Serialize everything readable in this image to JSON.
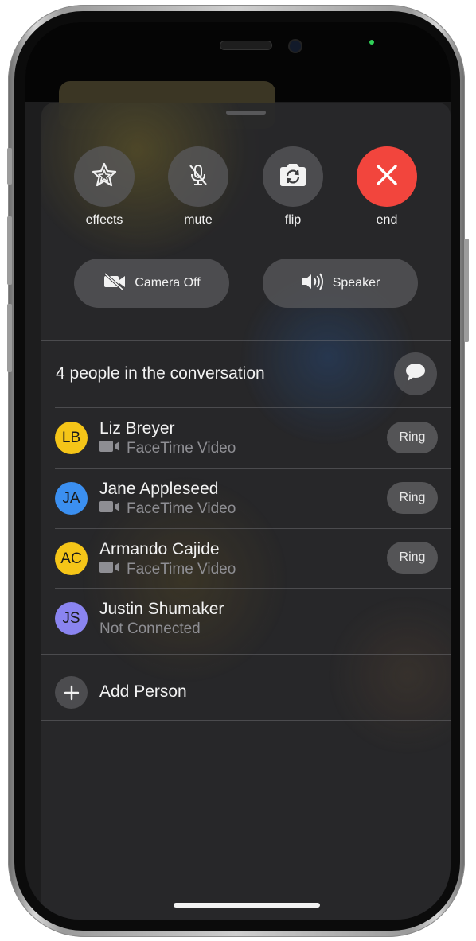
{
  "controls": {
    "effects_label": "effects",
    "mute_label": "mute",
    "flip_label": "flip",
    "end_label": "end",
    "camera_off_label": "Camera Off",
    "speaker_label": "Speaker"
  },
  "conversation": {
    "title": "4 people in the conversation",
    "ring_label": "Ring",
    "participants": [
      {
        "initials": "LB",
        "name": "Liz Breyer",
        "status": "FaceTime Video",
        "avatar_color": "#f5c518"
      },
      {
        "initials": "JA",
        "name": "Jane Appleseed",
        "status": "FaceTime Video",
        "avatar_color": "#3b8ff0"
      },
      {
        "initials": "AC",
        "name": "Armando Cajide",
        "status": "FaceTime Video",
        "avatar_color": "#f5c518"
      },
      {
        "initials": "JS",
        "name": "Justin Shumaker",
        "status": "Not Connected",
        "avatar_color": "#8a84f0"
      }
    ],
    "add_person_label": "Add Person"
  },
  "colors": {
    "end_red": "#f2453d",
    "indicator_green": "#30d158"
  },
  "icons": [
    "effects-star-icon",
    "mic-slash-icon",
    "camera-flip-icon",
    "close-icon",
    "video-slash-icon",
    "speaker-wave-icon",
    "message-bubble-icon",
    "video-camera-icon",
    "plus-icon"
  ]
}
